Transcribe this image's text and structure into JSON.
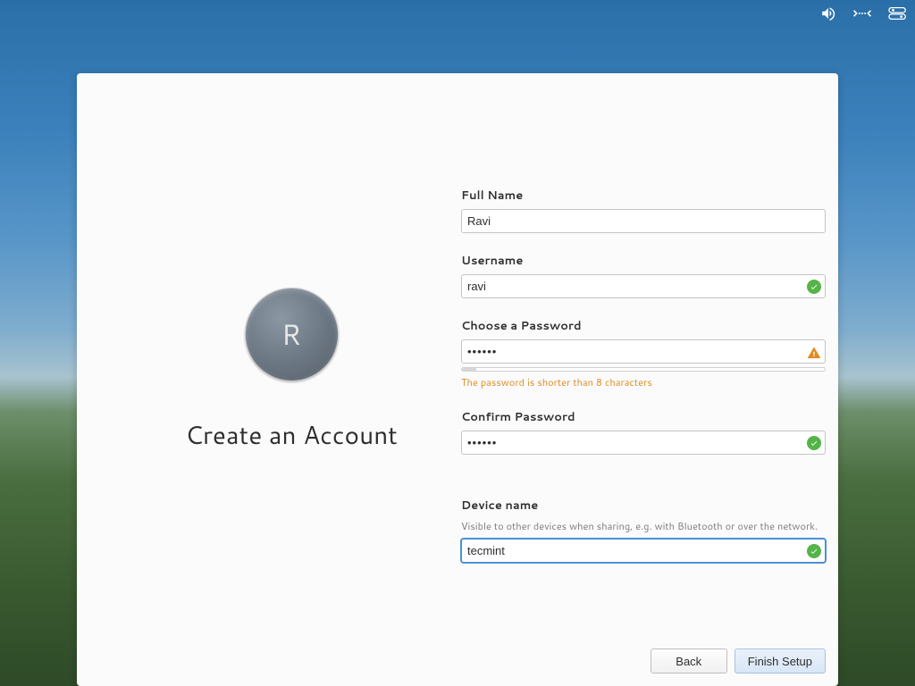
{
  "left": {
    "avatar_initial": "R",
    "title": "Create an Account"
  },
  "form": {
    "full_name": {
      "label": "Full Name",
      "value": "Ravi"
    },
    "username": {
      "label": "Username",
      "value": "ravi"
    },
    "password": {
      "label": "Choose a Password",
      "value": "••••••",
      "error": "The password is shorter than 8 characters"
    },
    "confirm": {
      "label": "Confirm Password",
      "value": "••••••"
    },
    "device": {
      "label": "Device name",
      "hint": "Visible to other devices when sharing, e.g. with Bluetooth or over the network.",
      "value": "tecmint"
    }
  },
  "buttons": {
    "back": "Back",
    "finish": "Finish Setup"
  },
  "tray": {
    "sound": "sound-icon",
    "network": "network-wired-icon",
    "power": "power-icon"
  }
}
